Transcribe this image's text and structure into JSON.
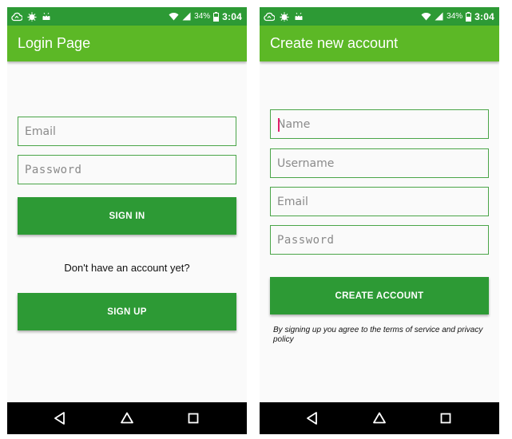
{
  "status_bar": {
    "battery_percent": "34%",
    "time": "3:04",
    "icons": [
      "cloud-sync-icon",
      "android-debug-icon",
      "android-head-icon",
      "wifi-icon",
      "signal-icon",
      "battery-charging-icon"
    ]
  },
  "login_screen": {
    "title": "Login Page",
    "email_placeholder": "Email",
    "password_placeholder": "Password",
    "sign_in_label": "SIGN IN",
    "no_account_text": "Don't have an account yet?",
    "sign_up_label": "SIGN UP"
  },
  "signup_screen": {
    "title": "Create new account",
    "name_placeholder": "Name",
    "username_placeholder": "Username",
    "email_placeholder": "Email",
    "password_placeholder": "Password",
    "create_account_label": "CREATE ACCOUNT",
    "terms_text": "By signing up you agree to the terms of service and privacy policy"
  },
  "navigation_bar": {
    "icons": [
      "back-icon",
      "home-icon",
      "recents-icon"
    ]
  },
  "colors": {
    "status_bar": "#2d9a35",
    "app_bar": "#5cb826",
    "button": "#2d9a35",
    "field_border": "#4aa548",
    "background": "#fafafa",
    "nav_bar": "#000000",
    "cursor": "#e0206a"
  }
}
